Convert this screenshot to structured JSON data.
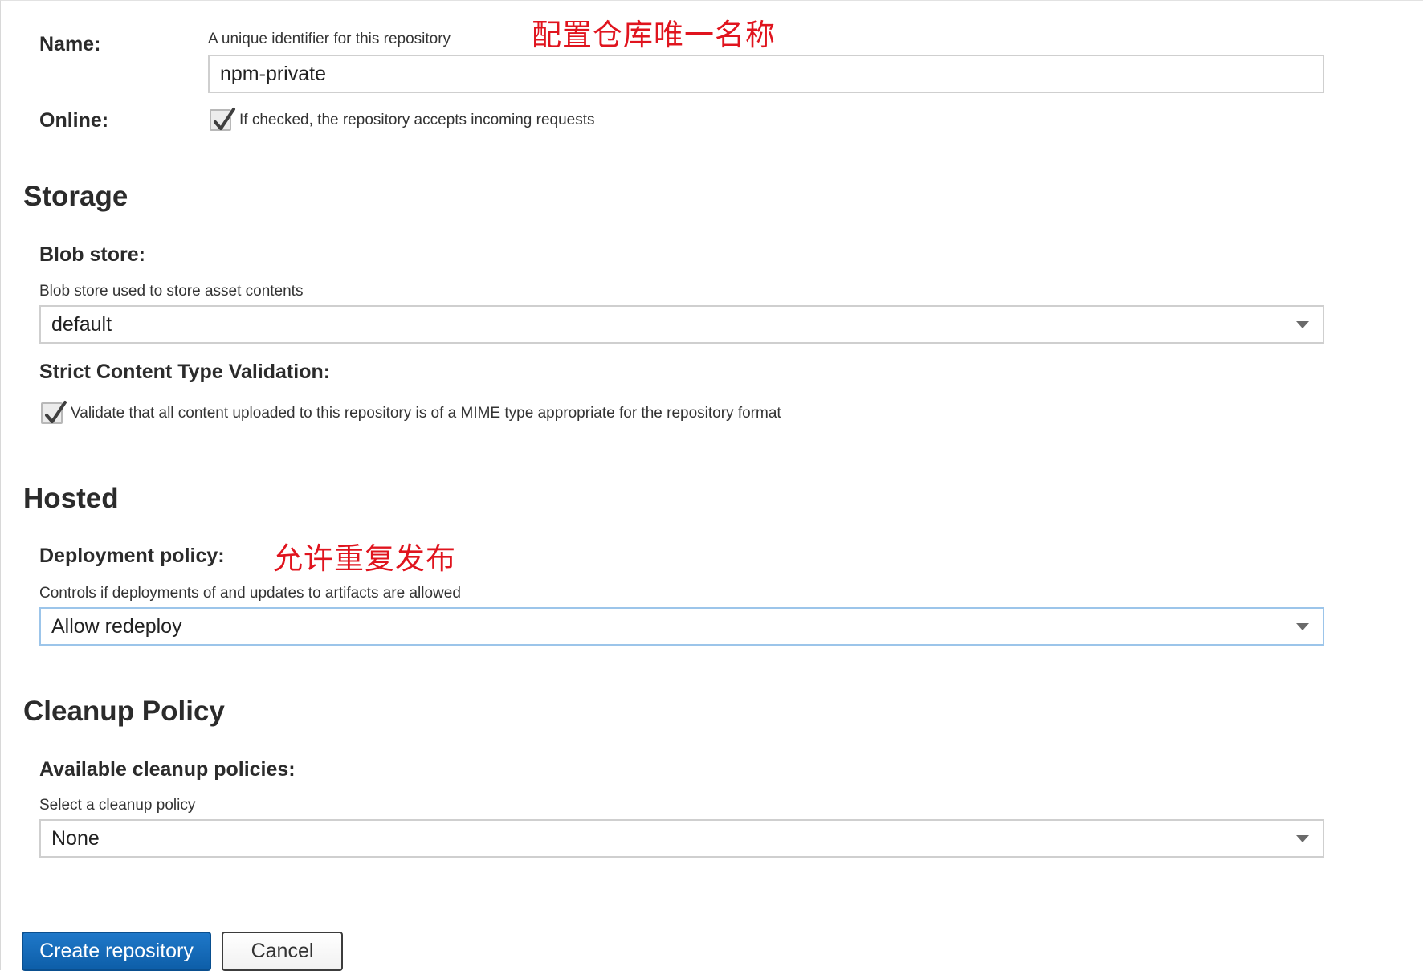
{
  "name_field": {
    "label": "Name:",
    "help": "A unique identifier for this repository",
    "value": "npm-private",
    "annotation": "配置仓库唯一名称"
  },
  "online_field": {
    "label": "Online:",
    "checked": true,
    "description": "If checked, the repository accepts incoming requests"
  },
  "storage": {
    "title": "Storage",
    "blob_store": {
      "label": "Blob store:",
      "help": "Blob store used to store asset contents",
      "value": "default"
    },
    "strict_validation": {
      "label": "Strict Content Type Validation:",
      "checked": true,
      "description": "Validate that all content uploaded to this repository is of a MIME type appropriate for the repository format"
    }
  },
  "hosted": {
    "title": "Hosted",
    "deployment_policy": {
      "label": "Deployment policy:",
      "annotation": "允许重复发布",
      "help": "Controls if deployments of and updates to artifacts are allowed",
      "value": "Allow redeploy"
    }
  },
  "cleanup": {
    "title": "Cleanup Policy",
    "available": {
      "label": "Available cleanup policies:",
      "help": "Select a cleanup policy",
      "value": "None"
    }
  },
  "actions": {
    "create_label": "Create repository",
    "cancel_label": "Cancel"
  },
  "colors": {
    "primary_button": "#1469b8",
    "annotation": "#e0141e",
    "focus_border": "#9cc5ea"
  },
  "icons": {
    "checkbox": "check-icon",
    "dropdown": "chevron-down-icon"
  }
}
